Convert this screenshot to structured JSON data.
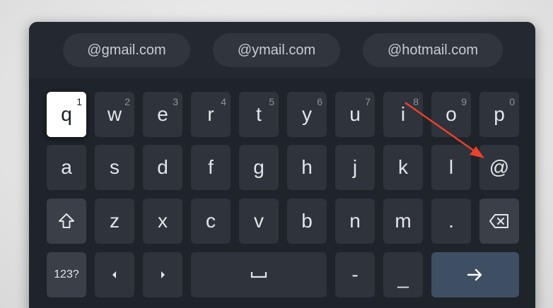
{
  "suggestions": [
    "@gmail.com",
    "@ymail.com",
    "@hotmail.com"
  ],
  "row1": [
    {
      "key": "q",
      "hint": "1",
      "pressed": true
    },
    {
      "key": "w",
      "hint": "2"
    },
    {
      "key": "e",
      "hint": "3"
    },
    {
      "key": "r",
      "hint": "4"
    },
    {
      "key": "t",
      "hint": "5"
    },
    {
      "key": "y",
      "hint": "6"
    },
    {
      "key": "u",
      "hint": "7"
    },
    {
      "key": "i",
      "hint": "8"
    },
    {
      "key": "o",
      "hint": "9"
    },
    {
      "key": "p",
      "hint": "0"
    }
  ],
  "row2": [
    "a",
    "s",
    "d",
    "f",
    "g",
    "h",
    "j",
    "k",
    "l",
    "@"
  ],
  "row3": [
    "z",
    "x",
    "c",
    "v",
    "b",
    "n",
    "m",
    "."
  ],
  "row4": {
    "symbols_label": "123?",
    "dash_label": "-",
    "underscore_label": "_"
  },
  "colors": {
    "keyboard_bg": "#1f232a",
    "key_bg": "#2f343c",
    "key_text": "#e3e5e8",
    "enter_bg": "#3f4f63",
    "annotation_arrow": "#e8412c"
  }
}
